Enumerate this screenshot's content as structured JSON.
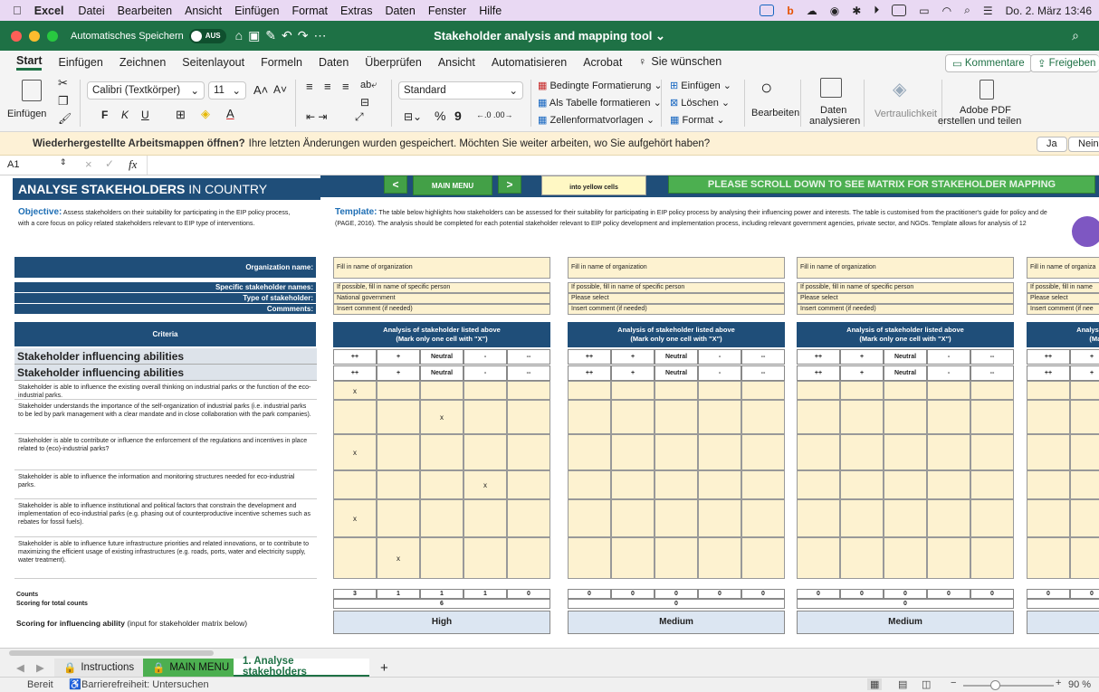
{
  "menubar": {
    "app": "Excel",
    "items": [
      "Datei",
      "Bearbeiten",
      "Ansicht",
      "Einfügen",
      "Format",
      "Extras",
      "Daten",
      "Fenster",
      "Hilfe"
    ],
    "datetime": "Do. 2. März 13:46"
  },
  "titlebar": {
    "autosave": "Automatisches Speichern",
    "autosave_state": "AUS",
    "doc_title": "Stakeholder analysis and mapping tool"
  },
  "ribbon_tabs": [
    "Start",
    "Einfügen",
    "Zeichnen",
    "Seitenlayout",
    "Formeln",
    "Daten",
    "Überprüfen",
    "Ansicht",
    "Automatisieren",
    "Acrobat"
  ],
  "tell_me": "Sie wünschen",
  "comments_btn": "Kommentare",
  "share_btn": "Freigeben",
  "ribbon": {
    "paste": "Einfügen",
    "font_name": "Calibri (Textkörper)",
    "font_size": "11",
    "bold": "F",
    "italic": "K",
    "underline": "U",
    "number_format": "Standard",
    "cond_format": "Bedingte Formatierung",
    "as_table": "Als Tabelle formatieren",
    "cell_styles": "Zellenformatvorlagen",
    "insert": "Einfügen",
    "delete": "Löschen",
    "format": "Format",
    "edit": "Bearbeiten",
    "analyze_1": "Daten",
    "analyze_2": "analysieren",
    "sensitivity": "Vertraulichkeit",
    "pdf_1": "Adobe PDF",
    "pdf_2": "erstellen und teilen"
  },
  "notification": {
    "bold_text": "Wiederhergestellte Arbeitsmappen öffnen?",
    "text": "Ihre letzten Änderungen wurden gespeichert. Möchten Sie weiter arbeiten, wo Sie aufgehört haben?",
    "yes": "Ja",
    "no": "Nein"
  },
  "formula_bar": {
    "cell_ref": "A1",
    "fx": "fx"
  },
  "sheet": {
    "title_bold": "ANALYSE STAKEHOLDERS",
    "title_rest": " IN COUNTRY",
    "nav_prev": "<",
    "nav_main": "MAIN MENU",
    "nav_next": ">",
    "yellow_note": "into yellow cells",
    "scroll_note": "PLEASE SCROLL DOWN TO SEE MATRIX FOR STAKEHOLDER MAPPING",
    "objective_label": "Objective:",
    "objective_text_1": "Assess stakeholders on their suitability for participating in the EIP policy process,",
    "objective_text_2": "with a core focus on policy related stakeholders relevant to EIP type of interventions.",
    "template_label": "Template:",
    "template_text_1": "The table below highlights how stakeholders can be assessed for their suitability for participating in EIP policy process by analysing their influencing power and interests. The table is customised from the practitioner's guide for policy and de",
    "template_text_2": "(PAGE, 2016). The analysis should be completed for each potential stakeholder relevant to EIP policy development and implementation process, including relevant government agencies, private sector, and NGOs. Template allows for analysis of 12",
    "labels": {
      "org": "Organization name:",
      "specific": "Specific stakeholder names:",
      "type": "Type of stakeholder:",
      "comments": "Commments:",
      "criteria": "Criteria"
    },
    "section_title": "Stakeholder influencing abilities",
    "criteria": [
      "Stakeholder is able to influence the existing overall thinking on industrial parks or the function of the eco-industrial parks.",
      "Stakeholder understands the importance of the self-organization of industrial parks (i.e. industrial parks to be led by park management with a clear mandate and in close collaboration with the park companies).",
      "Stakeholder is able to contribute or influence the enforcement of the regulations and incentives in place related to (eco)-industrial parks?",
      "Stakeholder is able to influence the information and monitoring structures needed for eco-industrial parks.",
      "Stakeholder is able to influence institutional and political factors that constrain the development and implementation of eco-industrial parks (e.g. phasing out of counterproductive incentive schemes such as rebates for fossil fuels).",
      "Stakeholder is able to influence future infrastructure priorities and related innovations, or to contribute to maximizing the efficient usage of existing infrastructures (e.g. roads, ports, water and electricity supply, water treatment)."
    ],
    "counts_label": "Counts",
    "total_label": "Scoring for total counts",
    "ability_label_bold": "Scoring for influencing ability",
    "ability_label_rest": " (input for stakeholder matrix below)",
    "scale": [
      "++",
      "+",
      "Neutral",
      "-",
      "--"
    ],
    "analysis_header_1": "Analysis of stakeholder listed above",
    "analysis_header_2": "(Mark only one cell with \"X\")",
    "blocks": [
      {
        "org": "Fill in name of organization",
        "specific": "If possible, fill in name of specific person",
        "type": "National government",
        "comment": "Insert comment (if needed)",
        "marks": [
          0,
          2,
          0,
          3,
          0,
          1
        ],
        "counts": [
          "3",
          "1",
          "1",
          "1",
          "0"
        ],
        "total": "6",
        "score": "High"
      },
      {
        "org": "Fill in name of organization",
        "specific": "If possible, fill in name of specific person",
        "type": "Please select",
        "comment": "Insert comment (if needed)",
        "marks": [
          -1,
          -1,
          -1,
          -1,
          -1,
          -1
        ],
        "counts": [
          "0",
          "0",
          "0",
          "0",
          "0"
        ],
        "total": "0",
        "score": "Medium"
      },
      {
        "org": "Fill in name of organization",
        "specific": "If possible, fill in name of specific person",
        "type": "Please select",
        "comment": "Insert comment (if needed)",
        "marks": [
          -1,
          -1,
          -1,
          -1,
          -1,
          -1
        ],
        "counts": [
          "0",
          "0",
          "0",
          "0",
          "0"
        ],
        "total": "0",
        "score": "Medium"
      },
      {
        "org": "Fill in name of organiza",
        "specific": "If possible, fill in name",
        "type": "Please select",
        "comment": "Insert comment (if nee",
        "marks": [
          -1,
          -1,
          -1,
          -1,
          -1,
          -1
        ],
        "counts": [
          "0",
          "0"
        ],
        "total": "",
        "score": ""
      }
    ],
    "mark_char": "x"
  },
  "sheet_tabs": {
    "instructions": "Instructions",
    "main_menu": "MAIN MENU",
    "active": "1. Analyse stakeholders",
    "add": "+"
  },
  "status": {
    "ready": "Bereit",
    "accessibility": "Barrierefreiheit: Untersuchen",
    "zoom": "90 %"
  }
}
